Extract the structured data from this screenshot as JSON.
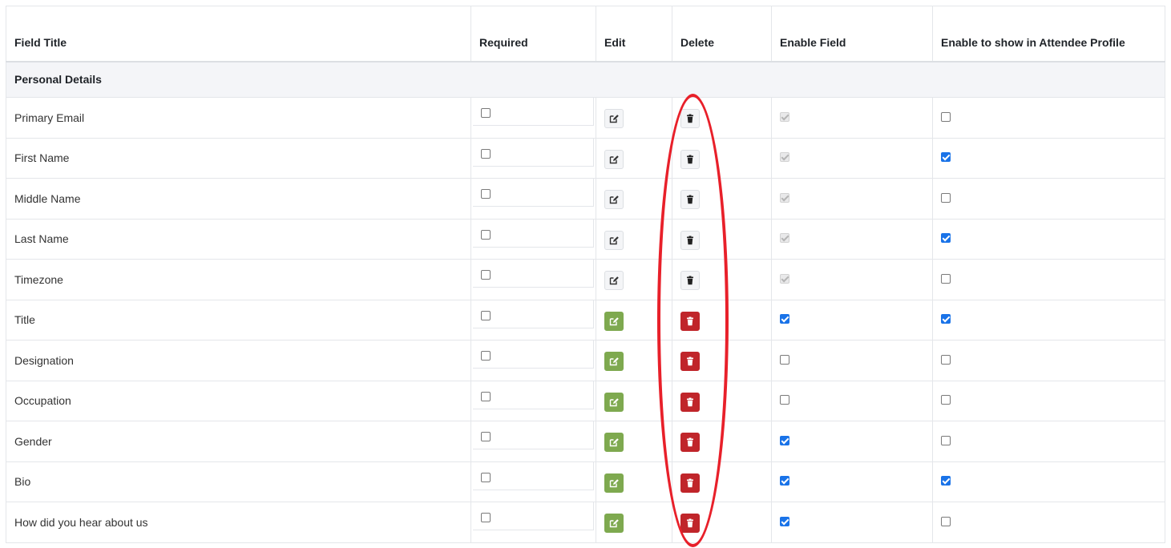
{
  "headers": {
    "field_title": "Field Title",
    "required": "Required",
    "edit": "Edit",
    "delete": "Delete",
    "enable_field": "Enable Field",
    "show_in_profile": "Enable to show in Attendee Profile"
  },
  "section": {
    "title": "Personal Details"
  },
  "rows": [
    {
      "title": "Primary Email",
      "required": false,
      "style": "default",
      "enable_field": "disabled",
      "show_in_profile": false
    },
    {
      "title": "First Name",
      "required": false,
      "style": "default",
      "enable_field": "disabled",
      "show_in_profile": true
    },
    {
      "title": "Middle Name",
      "required": false,
      "style": "default",
      "enable_field": "disabled",
      "show_in_profile": false
    },
    {
      "title": "Last Name",
      "required": false,
      "style": "default",
      "enable_field": "disabled",
      "show_in_profile": true
    },
    {
      "title": "Timezone",
      "required": false,
      "style": "default",
      "enable_field": "disabled",
      "show_in_profile": false
    },
    {
      "title": "Title",
      "required": false,
      "style": "custom",
      "enable_field": "checked",
      "show_in_profile": true
    },
    {
      "title": "Designation",
      "required": false,
      "style": "custom",
      "enable_field": "unchecked",
      "show_in_profile": false
    },
    {
      "title": "Occupation",
      "required": false,
      "style": "custom",
      "enable_field": "unchecked",
      "show_in_profile": false
    },
    {
      "title": "Gender",
      "required": false,
      "style": "custom",
      "enable_field": "checked",
      "show_in_profile": false
    },
    {
      "title": "Bio",
      "required": false,
      "style": "custom",
      "enable_field": "checked",
      "show_in_profile": true
    },
    {
      "title": "How did you hear about us",
      "required": false,
      "style": "custom",
      "enable_field": "checked",
      "show_in_profile": false
    }
  ],
  "icons": {
    "edit": "edit-icon",
    "delete": "trash-icon"
  },
  "colors": {
    "edit_custom": "#7ea94f",
    "delete_custom": "#c0252a",
    "checkbox_checked": "#1a73e8",
    "annotation": "#e8202a"
  }
}
